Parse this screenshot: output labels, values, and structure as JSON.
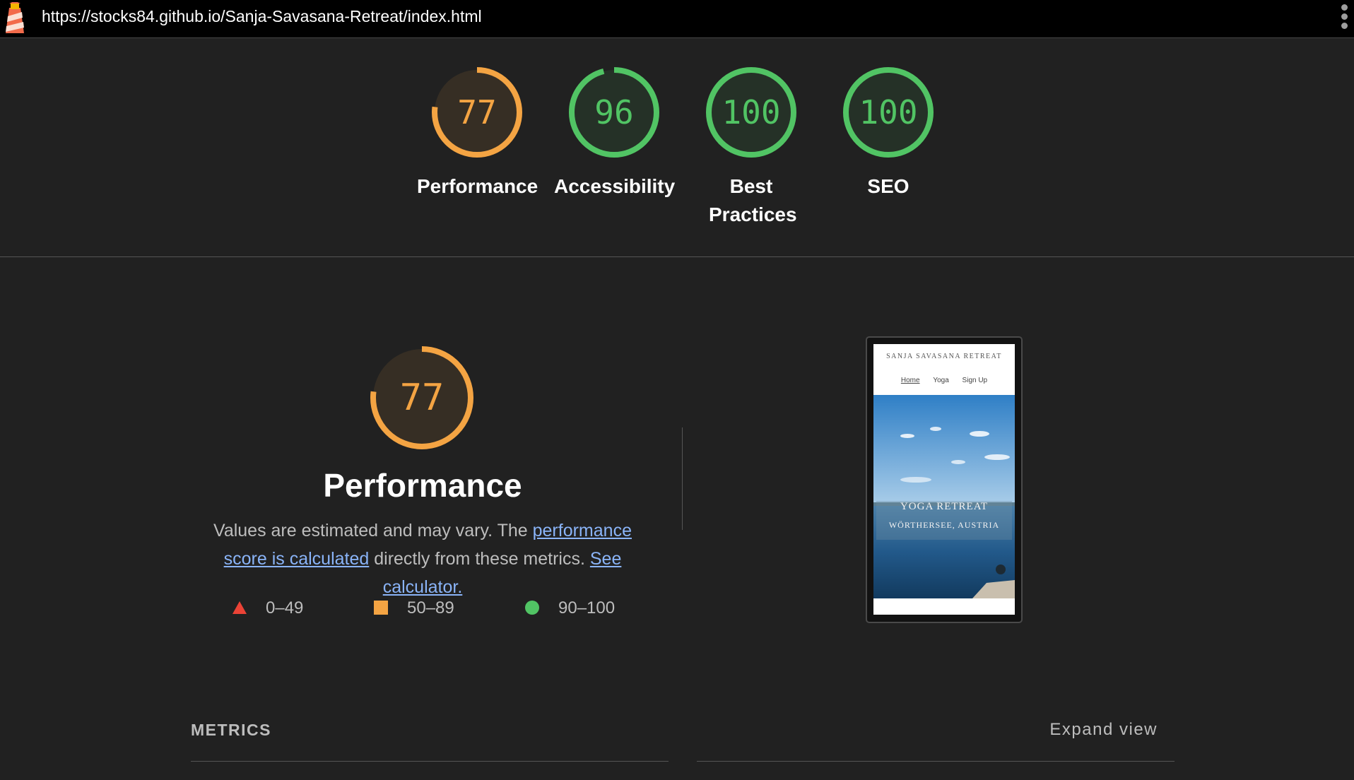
{
  "browser": {
    "url": "https://stocks84.github.io/Sanja-Savasana-Retreat/index.html"
  },
  "scores": [
    {
      "value": "77",
      "label": "Performance",
      "fraction": 0.77,
      "color": "#f4a443"
    },
    {
      "value": "96",
      "label": "Accessibility",
      "fraction": 0.96,
      "color": "#51c464"
    },
    {
      "value": "100",
      "label": "Best Practices",
      "fraction": 1.0,
      "color": "#51c464"
    },
    {
      "value": "100",
      "label": "SEO",
      "fraction": 1.0,
      "color": "#51c464"
    }
  ],
  "performance": {
    "score": "77",
    "fraction": 0.77,
    "title": "Performance",
    "desc_prefix": "Values are estimated and may vary. The ",
    "link_score": "performance score is calculated",
    "desc_middle": " directly from these metrics. ",
    "link_calculator": "See calculator."
  },
  "legend": [
    {
      "icon": "triangle-icon",
      "range": "0–49",
      "color": "#eb4336"
    },
    {
      "icon": "square-icon",
      "range": "50–89",
      "color": "#f4a443"
    },
    {
      "icon": "circle-icon",
      "range": "90–100",
      "color": "#51c464"
    }
  ],
  "thumbnail": {
    "site_title": "SANJA SAVASANA RETREAT",
    "nav": [
      "Home",
      "Yoga",
      "Sign Up"
    ],
    "hero_line1": "YOGA RETREAT",
    "hero_line2": "WÖRTHERSEE, AUSTRIA"
  },
  "metrics": {
    "heading": "METRICS",
    "expand_label": "Expand view"
  }
}
